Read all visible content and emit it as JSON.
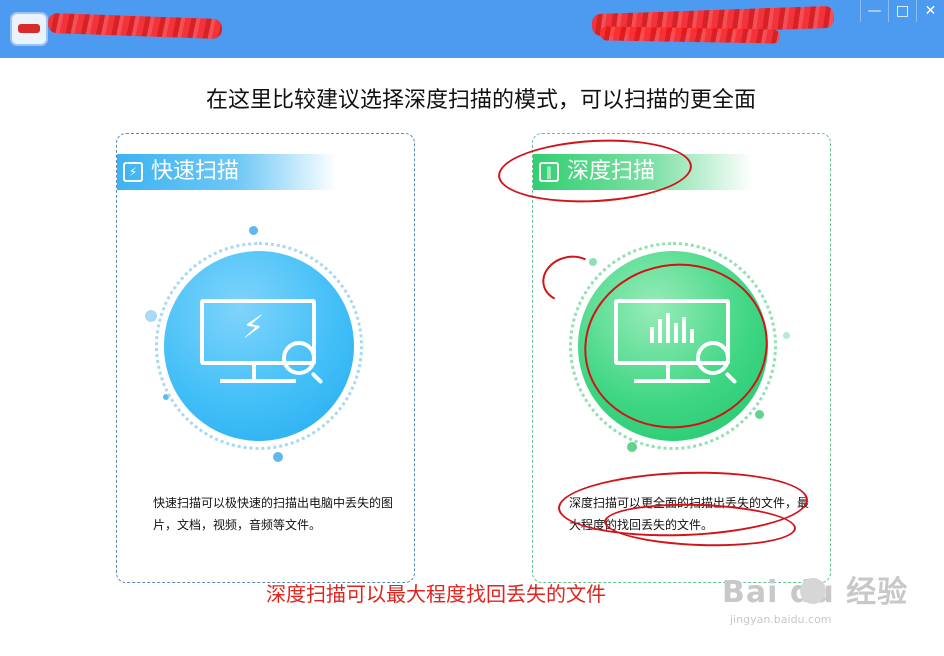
{
  "window": {
    "controls": {
      "minimize": "—",
      "maximize": "□",
      "close": "✕"
    }
  },
  "headline": "在这里比较建议选择深度扫描的模式，可以扫描的更全面",
  "cards": {
    "quick": {
      "title": "快速扫描",
      "description": "快速扫描可以极快速的扫描出电脑中丢失的图片，文档，视频，音频等文件。",
      "icon": "monitor-bolt-magnifier-icon",
      "color": "#3db3f2"
    },
    "deep": {
      "title": "深度扫描",
      "description": "深度扫描可以更全面的扫描出丢失的文件，最大程度的找回丢失的文件。",
      "icon": "monitor-bars-magnifier-icon",
      "color": "#31cf71"
    }
  },
  "footer_note": "深度扫描可以最大程度找回丢失的文件",
  "watermark": {
    "logo": "Bai du 经验",
    "url": "jingyan.baidu.com"
  },
  "colors": {
    "titlebar": "#4d9bf0",
    "annotation": "#d0141a",
    "footer_note": "#e0231c"
  }
}
